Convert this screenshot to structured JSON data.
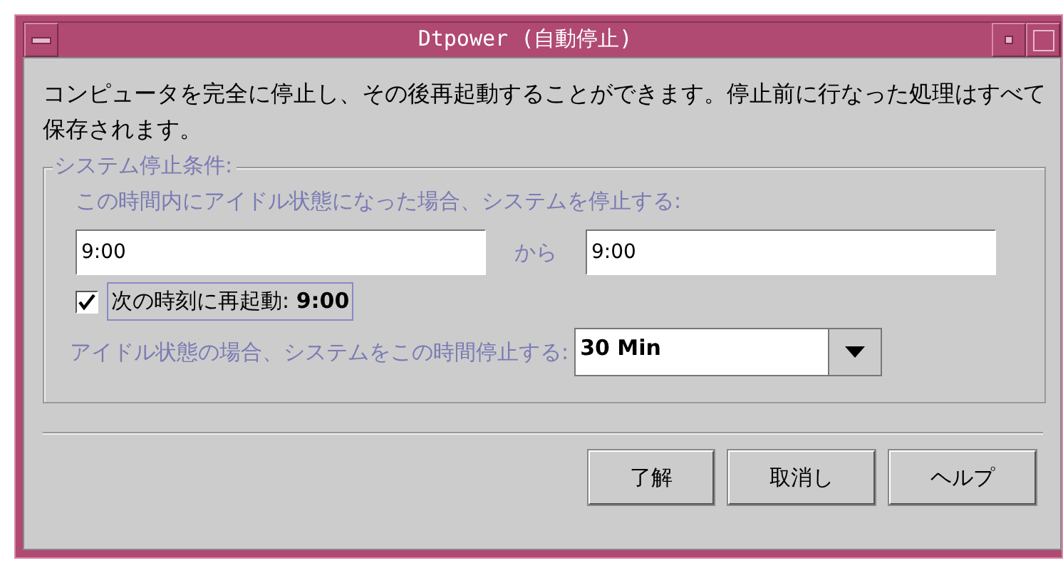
{
  "window": {
    "title": "Dtpower (自動停止)"
  },
  "description": "コンピュータを完全に停止し、その後再起動することができます。停止前に行なった処理はすべて保存されます。",
  "group": {
    "legend": "システム停止条件:",
    "range_label": "この時間内にアイドル状態になった場合、システムを停止する:",
    "start_time": {
      "value": "9:00"
    },
    "range_word": "から",
    "end_time": {
      "value": "9:00"
    },
    "restart": {
      "label": "次の時刻に再起動: **9:00**",
      "checked": true,
      "focused": true
    },
    "idle_label": "アイドル状態の場合、システムをこの時間停止する:",
    "idle_select": {
      "value": "30 Min"
    }
  },
  "buttons": [
    "了解",
    "取消し",
    "ヘルプ"
  ]
}
